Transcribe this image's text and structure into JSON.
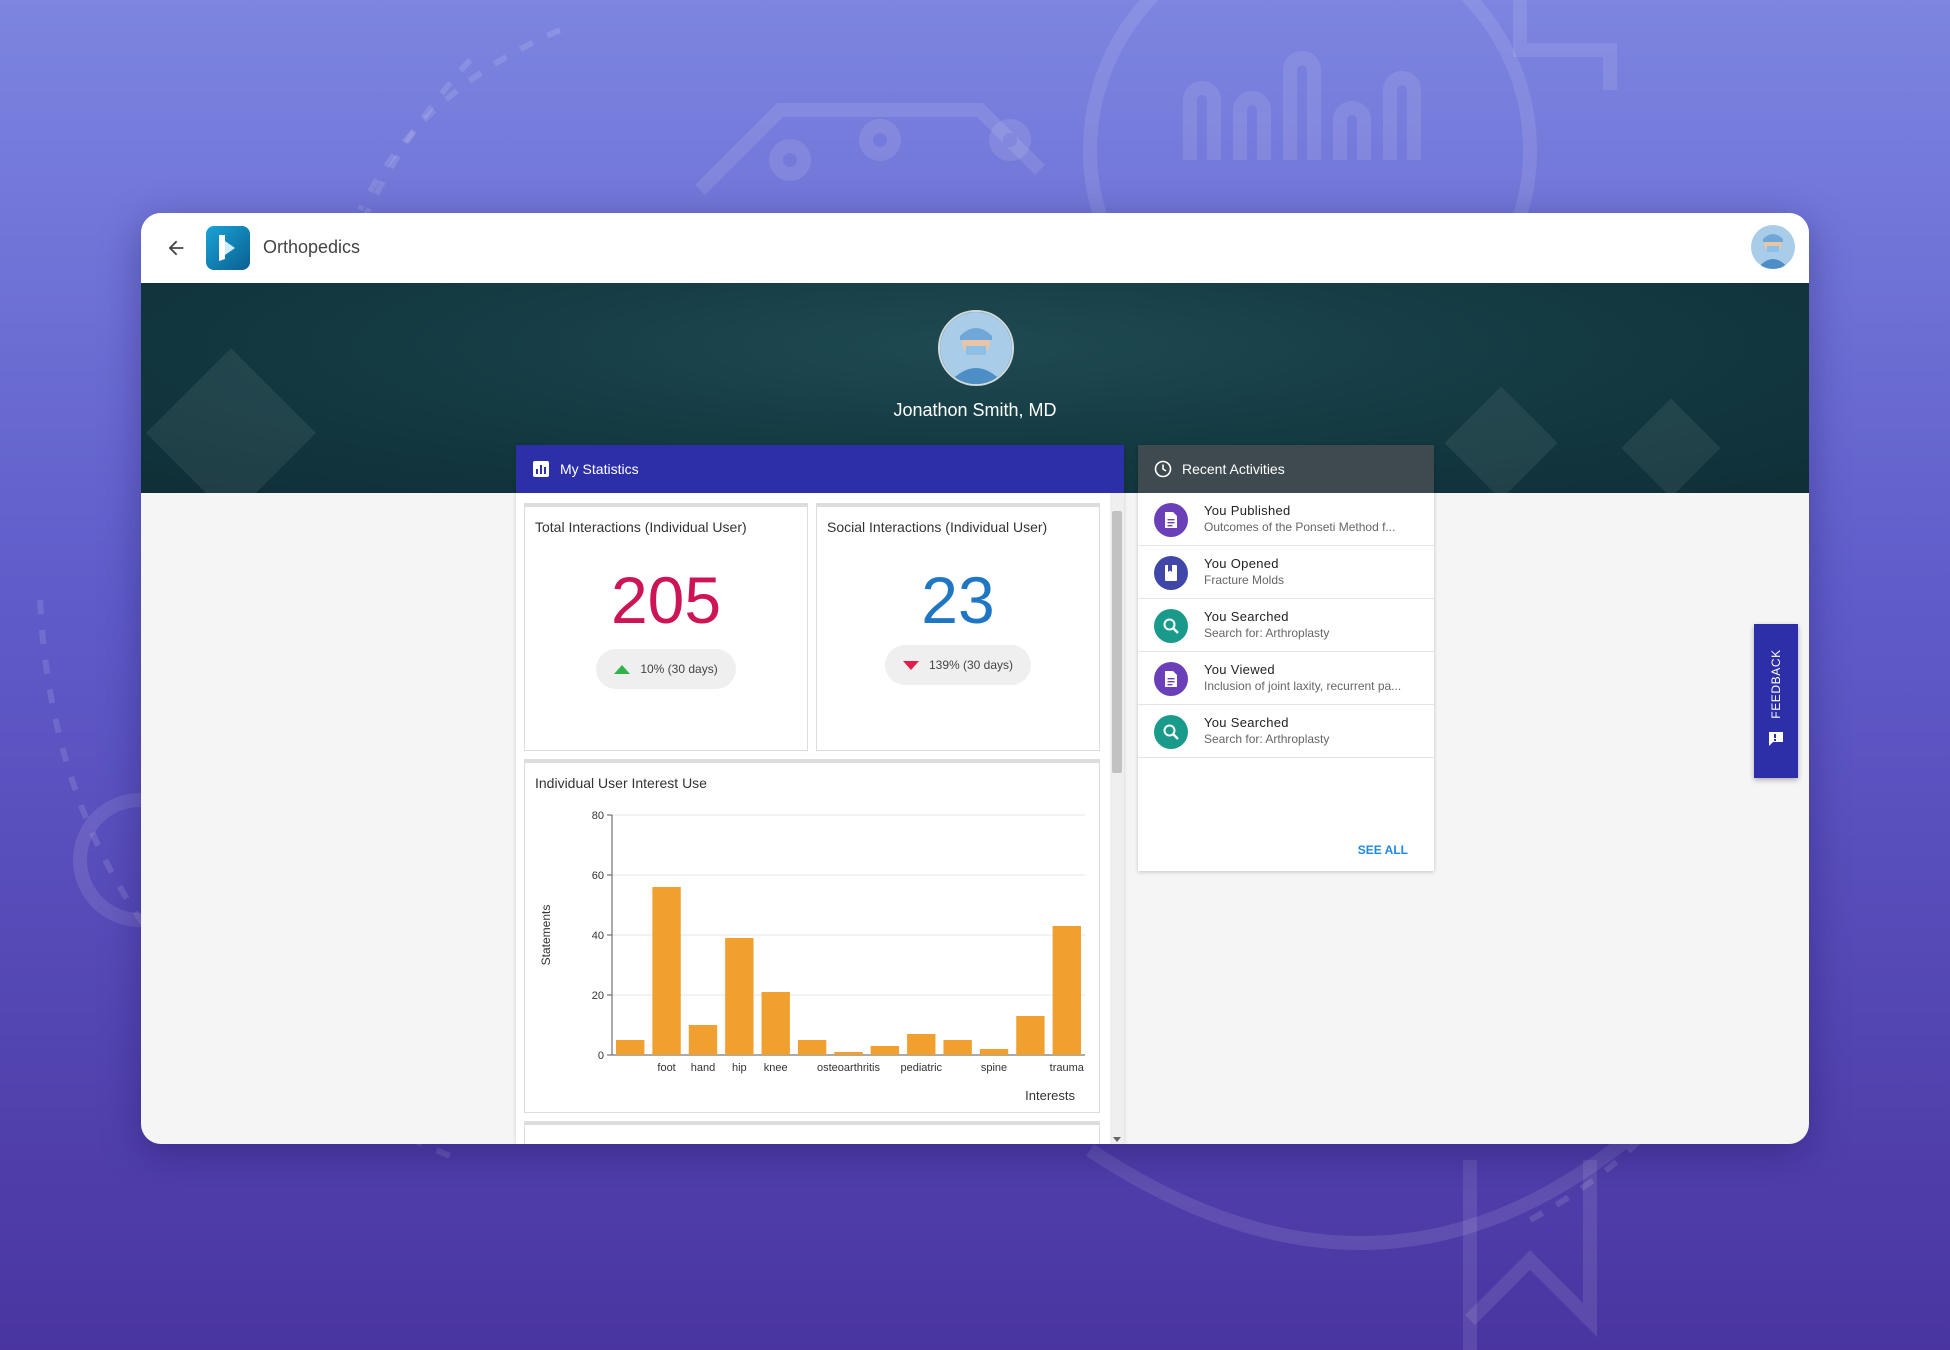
{
  "app": {
    "title": "Orthopedics"
  },
  "profile": {
    "name": "Jonathon Smith, MD"
  },
  "stats": {
    "header": "My Statistics",
    "total": {
      "title": "Total Interactions (Individual User)",
      "value": "205",
      "change": "10% (30 days)",
      "trend": "up",
      "color": "#cc1456"
    },
    "social": {
      "title": "Social Interactions (Individual User)",
      "value": "23",
      "change": "139% (30 days)",
      "trend": "down",
      "color": "#1f77c4"
    }
  },
  "chart_title": "Individual User Interest Use",
  "chart_data": {
    "type": "bar",
    "categories": [
      "",
      "foot",
      "hand",
      "hip",
      "knee",
      "",
      "osteoarthritis",
      "",
      "pediatric",
      "",
      "spine",
      "",
      "trauma"
    ],
    "values": [
      5,
      56,
      10,
      39,
      21,
      5,
      1,
      3,
      7,
      5,
      2,
      13,
      43
    ],
    "xlabel": "Interests",
    "ylabel": "Statements",
    "ylim": [
      0,
      80
    ],
    "yticks": [
      0,
      20,
      40,
      60,
      80
    ],
    "grid": true,
    "bar_color": "#f0a02e"
  },
  "activities": {
    "header": "Recent Activities",
    "items": [
      {
        "title": "You Published",
        "subtitle": "Outcomes of the Ponseti Method f...",
        "icon": "document-icon",
        "color": "#6a3fb8"
      },
      {
        "title": "You Opened",
        "subtitle": "Fracture Molds",
        "icon": "book-icon",
        "color": "#4147a8"
      },
      {
        "title": "You Searched",
        "subtitle": "Search for: Arthroplasty",
        "icon": "search-icon",
        "color": "#1a9a8a"
      },
      {
        "title": "You Viewed",
        "subtitle": "Inclusion of joint laxity, recurrent pa...",
        "icon": "document-icon",
        "color": "#6a3fb8"
      },
      {
        "title": "You Searched",
        "subtitle": "Search for: Arthroplasty",
        "icon": "search-icon",
        "color": "#1a9a8a"
      }
    ],
    "see_all": "SEE ALL"
  },
  "feedback": {
    "label": "FEEDBACK"
  }
}
